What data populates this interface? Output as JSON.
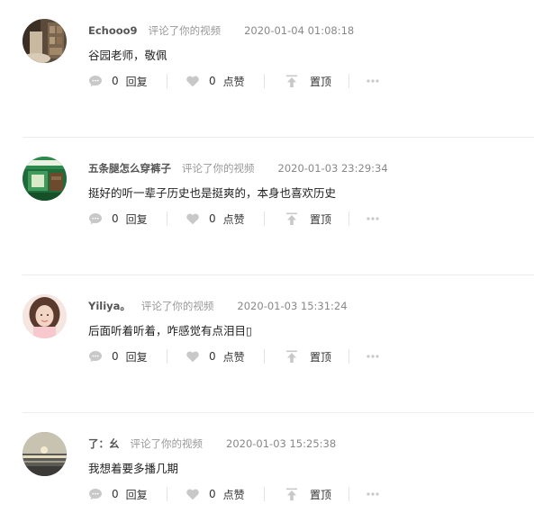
{
  "labels": {
    "action": "评论了你的视频",
    "reply": "回复",
    "like": "点赞",
    "pin": "置顶"
  },
  "comments": [
    {
      "user": "Echooo9",
      "time": "2020-01-04 01:08:18",
      "text": "谷园老师，敬佩",
      "reply_count": "0",
      "like_count": "0"
    },
    {
      "user": "五条腿怎么穿裤子",
      "time": "2020-01-03 23:29:34",
      "text": "挺好的听一辈子历史也是挺爽的，本身也喜欢历史",
      "reply_count": "0",
      "like_count": "0"
    },
    {
      "user": "Yiliya。",
      "time": "2020-01-03 15:31:24",
      "text": "后面听着听着，咋感觉有点泪目▯",
      "reply_count": "0",
      "like_count": "0"
    },
    {
      "user": "了：幺",
      "time": "2020-01-03 15:25:38",
      "text": "我想着要多播几期",
      "reply_count": "0",
      "like_count": "0"
    }
  ],
  "colors": {
    "icon": "#c8c8c8",
    "text": "#222222",
    "muted": "#999999",
    "divider": "#ececec"
  },
  "icons": [
    "comment-icon",
    "heart-icon",
    "pin-top-icon",
    "more-dots-icon"
  ]
}
